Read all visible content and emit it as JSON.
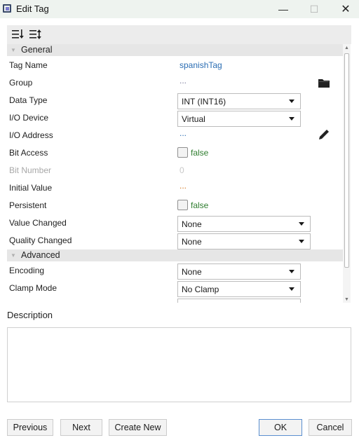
{
  "window": {
    "title": "Edit Tag",
    "minimize_glyph": "—",
    "maximize_glyph": "☐",
    "close_glyph": "✕"
  },
  "toolbar": {
    "icons": [
      "sort-categorized-icon",
      "sort-alphabetical-icon"
    ]
  },
  "sections": {
    "general": "General",
    "advanced": "Advanced"
  },
  "properties": {
    "tag_name": {
      "label": "Tag Name",
      "value": "spanishTag"
    },
    "group": {
      "label": "Group",
      "value": "..."
    },
    "data_type": {
      "label": "Data Type",
      "value": "INT (INT16)"
    },
    "io_device": {
      "label": "I/O Device",
      "value": "Virtual"
    },
    "io_address": {
      "label": "I/O Address",
      "value": "..."
    },
    "bit_access": {
      "label": "Bit Access",
      "value": "false",
      "checked": false
    },
    "bit_number": {
      "label": "Bit Number",
      "value": "0"
    },
    "initial_value": {
      "label": "Initial Value",
      "value": "..."
    },
    "persistent": {
      "label": "Persistent",
      "value": "false",
      "checked": false
    },
    "value_changed": {
      "label": "Value Changed",
      "value": "None"
    },
    "quality_changed": {
      "label": "Quality Changed",
      "value": "None"
    },
    "encoding": {
      "label": "Encoding",
      "value": "None"
    },
    "clamp_mode": {
      "label": "Clamp Mode",
      "value": "No Clamp"
    }
  },
  "description": {
    "label": "Description",
    "value": ""
  },
  "buttons": {
    "previous": "Previous",
    "next": "Next",
    "create_new": "Create New",
    "ok": "OK",
    "cancel": "Cancel"
  },
  "colors": {
    "value_blue": "#2a6db3",
    "bool_green": "#2f7d2f",
    "ellipsis_orange": "#d4761c",
    "ok_border": "#5b8fd0"
  }
}
